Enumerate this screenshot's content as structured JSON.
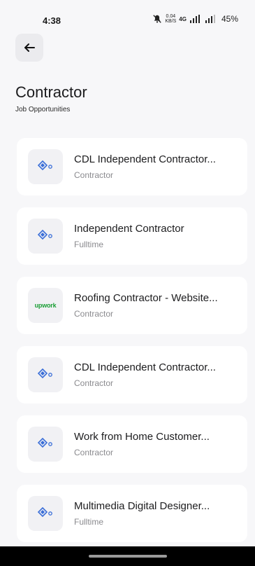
{
  "status_bar": {
    "time": "4:38",
    "net_speed_value": "0.04",
    "net_speed_unit": "KB/S",
    "network_type": "4G",
    "battery": "45%"
  },
  "header": {
    "title": "Contractor",
    "subtitle": "Job Opportunities"
  },
  "jobs": [
    {
      "title": "CDL Independent Contractor...",
      "type": "Contractor",
      "logo": "company-logo-icon"
    },
    {
      "title": "Independent Contractor",
      "type": "Fulltime",
      "logo": "company-logo-icon"
    },
    {
      "title": "Roofing Contractor - Website...",
      "type": "Contractor",
      "logo": "upwork",
      "logo_text": "upwork"
    },
    {
      "title": "CDL Independent Contractor...",
      "type": "Contractor",
      "logo": "company-logo-icon"
    },
    {
      "title": "Work from Home Customer...",
      "type": "Contractor",
      "logo": "company-logo-icon"
    },
    {
      "title": "Multimedia Digital Designer...",
      "type": "Fulltime",
      "logo": "company-logo-icon"
    }
  ],
  "colors": {
    "background": "#f7f7f9",
    "card": "#ffffff",
    "logo_blue": "#3b6fd8",
    "upwork_green": "#1a9e35"
  }
}
